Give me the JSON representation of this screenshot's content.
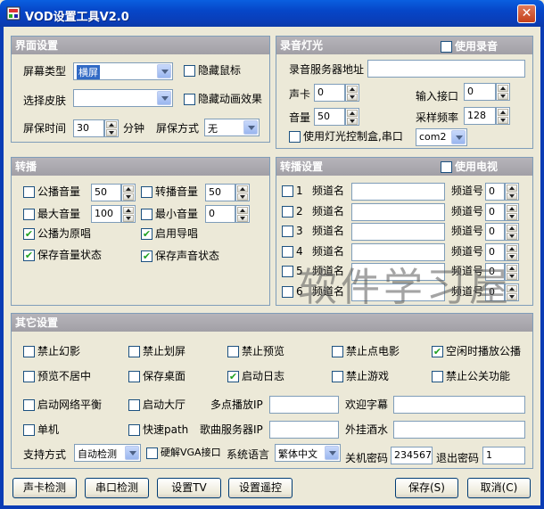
{
  "window": {
    "title": "VOD设置工具V2.0",
    "close_label": "✕"
  },
  "ui": {
    "title": "界面设置",
    "screen_type_label": "屏幕类型",
    "screen_type_value": "横屏",
    "hide_mouse": "隐藏鼠标",
    "skin_label": "选择皮肤",
    "skin_value": "",
    "hide_anim": "隐藏动画效果",
    "saver_time_label": "屏保时间",
    "saver_time_value": "30",
    "minute_label": "分钟",
    "saver_mode_label": "屏保方式",
    "saver_mode_value": "无"
  },
  "record": {
    "title": "录音灯光",
    "use_record": "使用录音",
    "server_label": "录音服务器地址",
    "server_value": "",
    "card_label": "声卡",
    "card_value": "0",
    "input_port_label": "输入接口",
    "input_port_value": "0",
    "volume_label": "音量",
    "volume_value": "50",
    "sample_label": "采样频率",
    "sample_value": "128",
    "light_box_label": "使用灯光控制盒,串口",
    "com_value": "com2"
  },
  "broadcast": {
    "title": "转播",
    "public_volume": "公播音量",
    "public_volume_value": "50",
    "relay_volume": "转播音量",
    "relay_volume_value": "50",
    "max_volume": "最大音量",
    "max_volume_value": "100",
    "min_volume": "最小音量",
    "min_volume_value": "0",
    "public_original": "公播为原唱",
    "enable_guide": "启用导唱",
    "save_volume_state": "保存音量状态",
    "save_sound_state": "保存声音状态"
  },
  "relay": {
    "title": "转播设置",
    "use_tv": "使用电视",
    "channel_name_label": "频道名",
    "channel_no_label": "频道号",
    "rows": [
      {
        "index": "1",
        "name": "",
        "number": "0"
      },
      {
        "index": "2",
        "name": "",
        "number": "0"
      },
      {
        "index": "3",
        "name": "",
        "number": "0"
      },
      {
        "index": "4",
        "name": "",
        "number": "0"
      },
      {
        "index": "5",
        "name": "",
        "number": "0"
      },
      {
        "index": "6",
        "name": "",
        "number": "0"
      }
    ]
  },
  "other": {
    "title": "其它设置",
    "no_phantom": "禁止幻影",
    "no_scroll": "禁止划屏",
    "no_preview": "禁止预览",
    "no_song_request": "禁止点电影",
    "idle_public": "空闲时播放公播",
    "preview_off_center": "预览不居中",
    "save_desktop": "保存桌面",
    "enable_log": "启动日志",
    "no_game": "禁止游戏",
    "no_public_func": "禁止公关功能",
    "net_balance": "启动网络平衡",
    "start_hall": "启动大厅",
    "multi_ip_label": "多点播放IP",
    "multi_ip_value": "",
    "welcome_label": "欢迎字幕",
    "welcome_value": "",
    "standalone": "单机",
    "quick_path": "快速path",
    "song_server_label": "歌曲服务器IP",
    "song_server_value": "",
    "external_wine_label": "外挂酒水",
    "external_wine_value": "",
    "support_label": "支持方式",
    "support_value": "自动检测",
    "hw_vga": "硬解VGA接口",
    "lang_label": "系统语言",
    "lang_value": "繁体中文",
    "shutdown_pwd_label": "关机密码",
    "shutdown_pwd_value": "234567",
    "exit_pwd_label": "退出密码",
    "exit_pwd_value": "1"
  },
  "buttons": {
    "card_test": "声卡检测",
    "serial_test": "串口检测",
    "set_tv": "设置TV",
    "set_remote": "设置遥控",
    "save": "保存(S)",
    "cancel": "取消(C)"
  },
  "watermark": "软件学习屋",
  "icons": {
    "app": "app-icon",
    "close": "close-icon",
    "check": "checkmark-icon"
  },
  "colors": {
    "titlebar": "#0a5fe0",
    "panel_header": "#a9a7ad",
    "selection": "#316ac5",
    "check": "#21a121"
  }
}
